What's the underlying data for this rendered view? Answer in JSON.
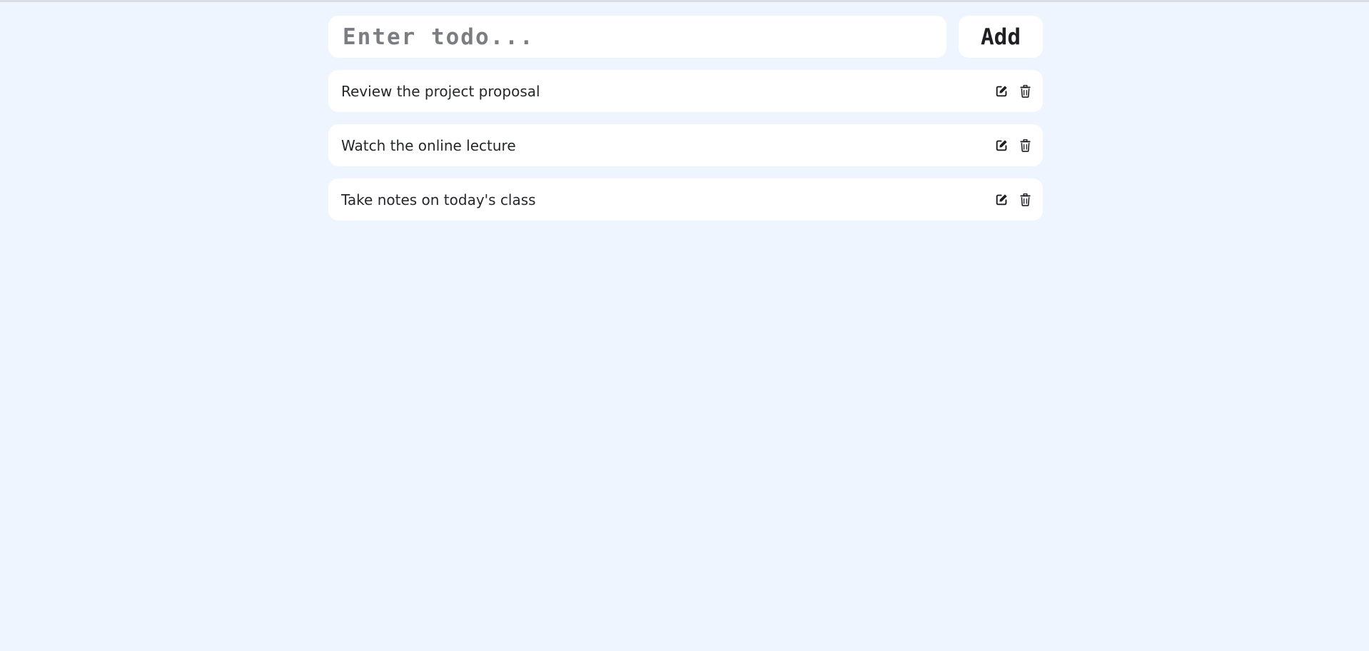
{
  "new_todo": {
    "placeholder": "Enter todo...",
    "value": ""
  },
  "add_button": {
    "label": "Add"
  },
  "todos": [
    {
      "text": "Review the project proposal",
      "edit_icon": "edit-icon",
      "delete_icon": "trash-icon"
    },
    {
      "text": "Watch the online lecture",
      "edit_icon": "edit-icon",
      "delete_icon": "trash-icon"
    },
    {
      "text": "Take notes on today's class",
      "edit_icon": "edit-icon",
      "delete_icon": "trash-icon"
    }
  ],
  "colors": {
    "background": "#eef5fe",
    "card": "#ffffff",
    "text": "#26272b",
    "placeholder": "#7b7d82"
  }
}
